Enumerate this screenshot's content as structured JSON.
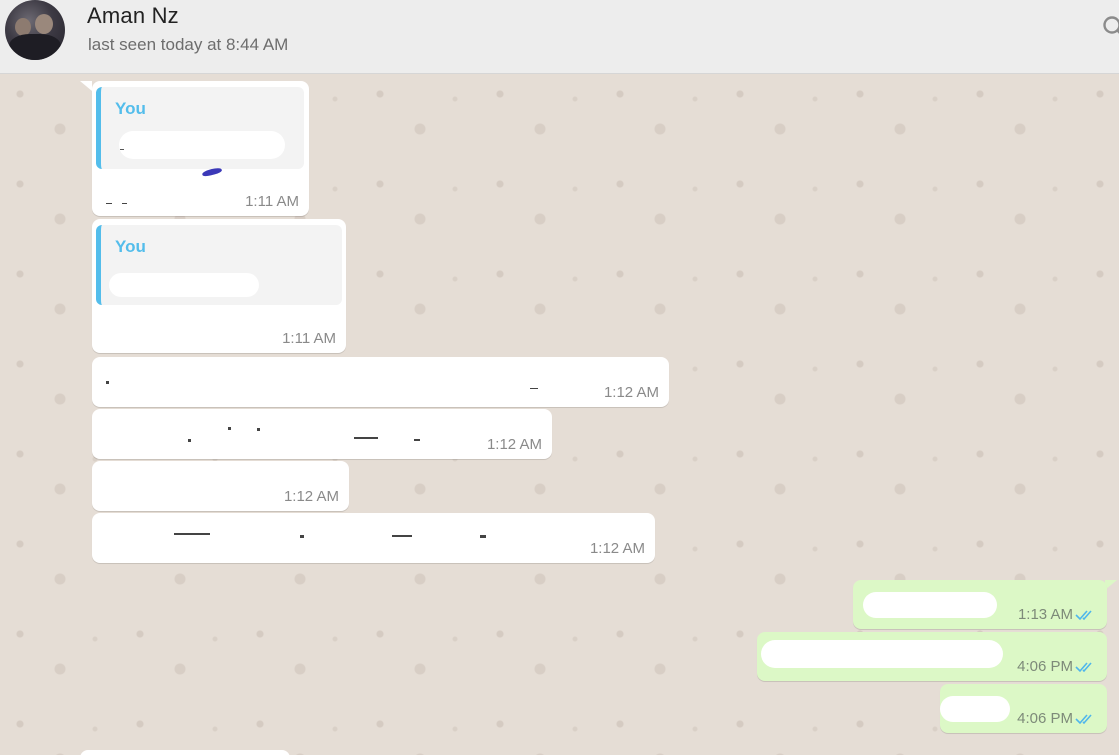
{
  "header": {
    "contact_name": "Aman Nz",
    "status": "last seen today at 8:44 AM",
    "icons": [
      "avatar",
      "search-icon"
    ]
  },
  "messages": [
    {
      "direction": "in",
      "quote_author": "You",
      "time": "1:11 AM"
    },
    {
      "direction": "in",
      "quote_author": "You",
      "time": "1:11 AM"
    },
    {
      "direction": "in",
      "time": "1:12 AM"
    },
    {
      "direction": "in",
      "time": "1:12 AM"
    },
    {
      "direction": "in",
      "time": "1:12 AM"
    },
    {
      "direction": "in",
      "time": "1:12 AM"
    },
    {
      "direction": "out",
      "time": "1:13 AM",
      "status": "read"
    },
    {
      "direction": "out",
      "time": "4:06 PM",
      "status": "read"
    },
    {
      "direction": "out",
      "time": "4:06 PM",
      "status": "read"
    }
  ],
  "colors": {
    "incoming_bubble": "#ffffff",
    "outgoing_bubble": "#dcf8c6",
    "quote_accent": "#53bdeb",
    "read_ticks": "#4fb6ec",
    "chat_background": "#e5ddd5"
  }
}
